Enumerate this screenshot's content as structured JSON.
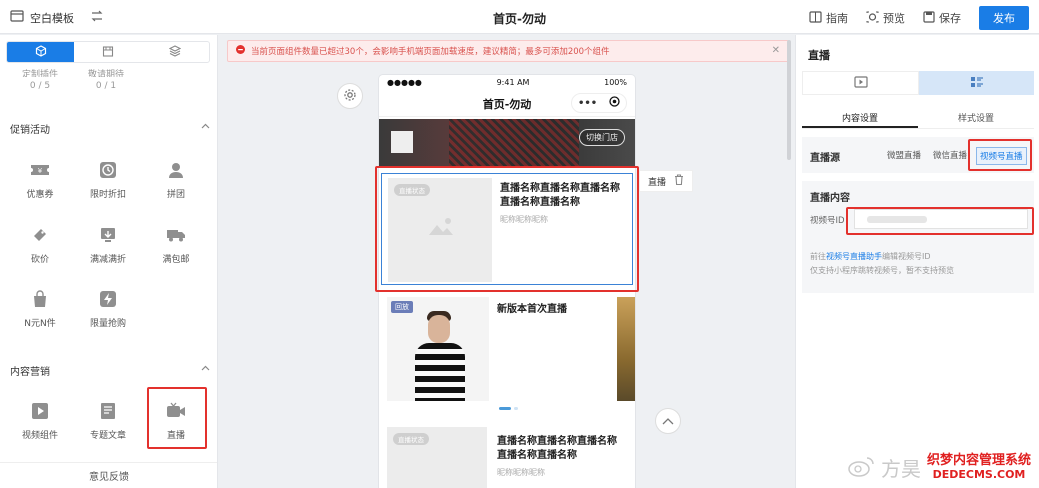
{
  "topbar": {
    "template_label": "空白模板",
    "page_title": "首页-勿动",
    "guide_label": "指南",
    "preview_label": "预览",
    "save_label": "保存",
    "publish_label": "发布"
  },
  "left": {
    "pre_row": [
      {
        "label": "定制插件",
        "count": "0 / 5"
      },
      {
        "label": "敬请期待",
        "count": "0 / 1"
      }
    ],
    "promotion_section": "促销活动",
    "promotion_items": [
      {
        "label": "优惠券",
        "icon": "coupon-icon"
      },
      {
        "label": "限时折扣",
        "icon": "clock-icon"
      },
      {
        "label": "拼团",
        "icon": "group-icon"
      },
      {
        "label": "砍价",
        "icon": "bargain-icon"
      },
      {
        "label": "满减满折",
        "icon": "discount-icon"
      },
      {
        "label": "满包邮",
        "icon": "truck-icon"
      },
      {
        "label": "N元N件",
        "icon": "bag-icon"
      },
      {
        "label": "限量抢购",
        "icon": "flash-icon"
      }
    ],
    "content_section": "内容营销",
    "content_items": [
      {
        "label": "视频组件",
        "icon": "video-icon"
      },
      {
        "label": "专题文章",
        "icon": "article-icon"
      },
      {
        "label": "直播",
        "icon": "live-icon"
      }
    ],
    "feedback_label": "意见反馈"
  },
  "canvas": {
    "alert_text": "当前页面组件数量已超过30个，会影响手机端页面加载速度，建议精简；最多可添加200个组件",
    "phone": {
      "status_signal": "●●●●● ",
      "status_time": "9:41 AM",
      "status_battery": "100%",
      "nav_title": "首页-勿动",
      "switch_store": "切换门店",
      "live_tag": "直播状态",
      "live_title": "直播名称直播名称直播名称直播名称直播名称",
      "live_sub": "昵称昵称昵称",
      "replay_tag": "回放",
      "video_title": "新版本首次直播",
      "live2_title": "直播名称直播名称直播名称直播名称直播名称",
      "live2_sub": "昵称昵称昵称"
    },
    "float_op_label": "直播"
  },
  "right": {
    "title": "直播",
    "tab_content": "内容设置",
    "tab_style": "样式设置",
    "source_label": "直播源",
    "source_options": [
      "微盟直播",
      "微信直播",
      "视频号直播"
    ],
    "content_title": "直播内容",
    "channel_id_label": "视频号ID",
    "hint_prefix": "前往",
    "hint_link": "视频号直播助手",
    "hint_suffix": "编辑视频号ID",
    "hint_line2": "仅支持小程序跳转视频号，暂不支持预览"
  },
  "watermark": {
    "text": "方昊",
    "dede_line1": "织梦内容管理系统",
    "dede_line2": "DEDECMS.COM"
  },
  "colors": {
    "accent": "#1a7de6",
    "highlight": "#e3312d",
    "alert_bg": "#fdecec"
  }
}
